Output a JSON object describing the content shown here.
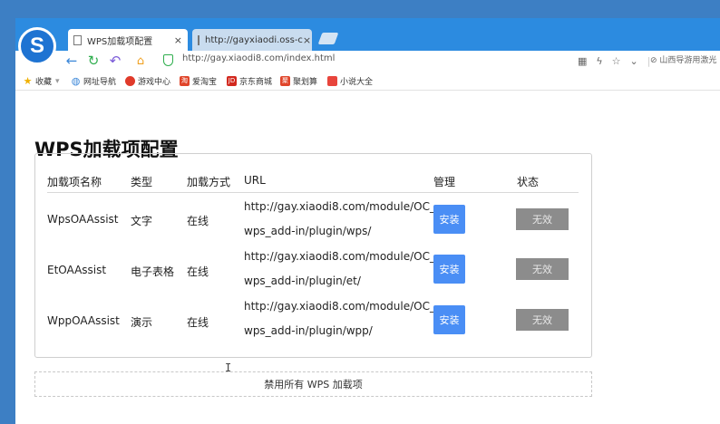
{
  "browser": {
    "tabs": [
      {
        "label": "WPS加载项配置",
        "close": "×"
      },
      {
        "label": "http://gayxiaodi.oss-c",
        "close": "×"
      }
    ],
    "url": "http://gay.xiaodi8.com/index.html",
    "search_placeholder": "山西导游用激光",
    "bookmarks": [
      {
        "label": "收藏",
        "icon": "star-icon"
      },
      {
        "label": "网址导航",
        "icon": "globe-icon"
      },
      {
        "label": "游戏中心",
        "icon": "game-icon"
      },
      {
        "label": "爱淘宝",
        "icon": "taobao-icon"
      },
      {
        "label": "京东商城",
        "icon": "jd-icon"
      },
      {
        "label": "聚划算",
        "icon": "juhuasuan-icon"
      },
      {
        "label": "小说大全",
        "icon": "novel-icon"
      }
    ]
  },
  "page": {
    "title": "WPS加载项配置",
    "table": {
      "headers": [
        "加载项名称",
        "类型",
        "加载方式",
        "URL",
        "管理",
        "状态"
      ],
      "rows": [
        {
          "name": "WpsOAAssist",
          "type": "文字",
          "mode": "在线",
          "url_line1": "http://gay.xiaodi8.com/module/OC_",
          "url_line2": "wps_add-in/plugin/wps/",
          "action": "安装",
          "status": "无效"
        },
        {
          "name": "EtOAAssist",
          "type": "电子表格",
          "mode": "在线",
          "url_line1": "http://gay.xiaodi8.com/module/OC_",
          "url_line2": "wps_add-in/plugin/et/",
          "action": "安装",
          "status": "无效"
        },
        {
          "name": "WppOAAssist",
          "type": "演示",
          "mode": "在线",
          "url_line1": "http://gay.xiaodi8.com/module/OC_",
          "url_line2": "wps_add-in/plugin/wpp/",
          "action": "安装",
          "status": "无效"
        }
      ]
    },
    "disable_all_label": "禁用所有 WPS 加载项"
  },
  "colors": {
    "frame": "#3d7fc4",
    "tabstrip": "#2c8be0",
    "install_button": "#4a8ef5",
    "status_button": "#8c8c8c"
  }
}
